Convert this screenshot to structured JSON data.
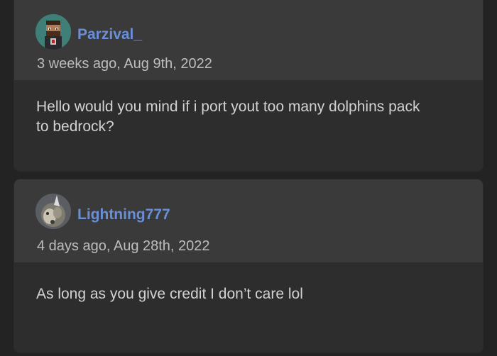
{
  "comments": [
    {
      "username": "Parzival_",
      "timestamp": "3 weeks ago, Aug 9th, 2022",
      "body": "Hello would you mind if i port yout too many dolphins pack to bedrock?",
      "avatar_icon": "pixel-character-avatar",
      "username_color": "#6b8fd6"
    },
    {
      "username": "Lightning777",
      "timestamp": "4 days ago, Aug 28th, 2022",
      "body": "As long as you give credit I don’t care lol",
      "avatar_icon": "creature-photo-avatar",
      "username_color": "#6b8fd6"
    }
  ]
}
